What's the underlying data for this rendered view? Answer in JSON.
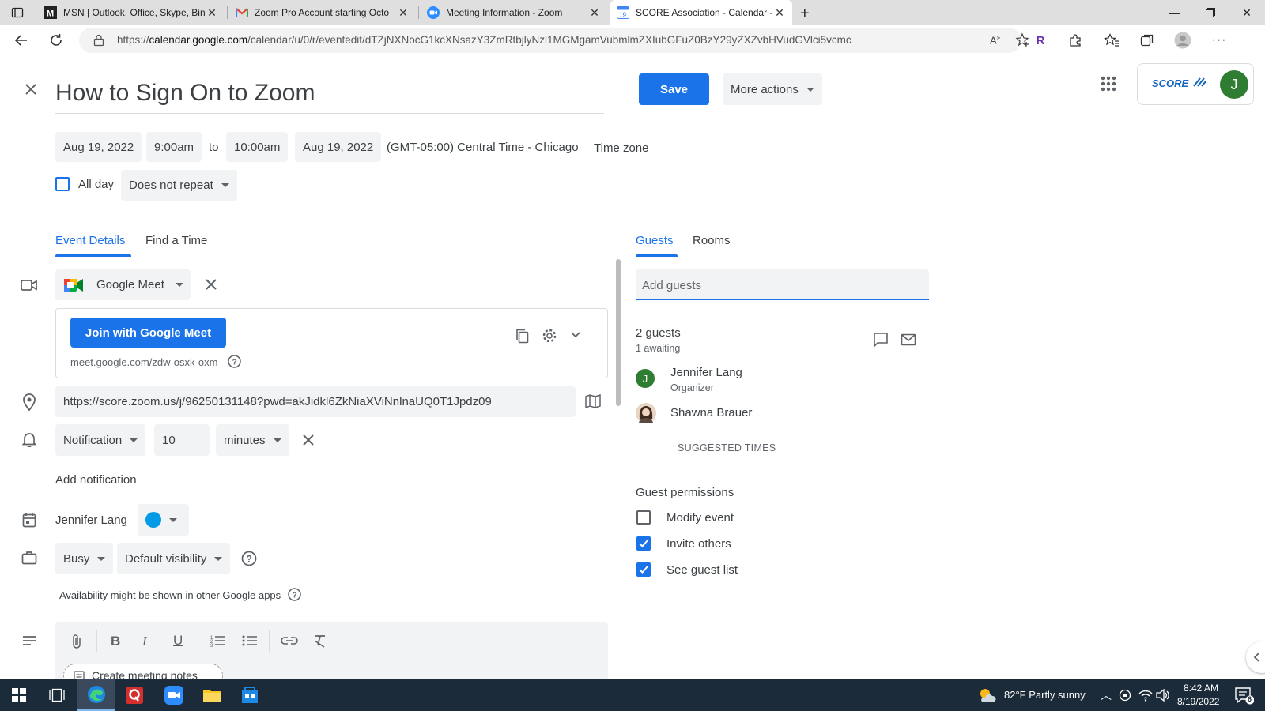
{
  "browser": {
    "tabs": [
      {
        "title": "MSN | Outlook, Office, Skype, Bing"
      },
      {
        "title": "Zoom Pro Account starting Octo"
      },
      {
        "title": "Meeting Information - Zoom"
      },
      {
        "title": "SCORE Association - Calendar - E"
      }
    ],
    "url_prefix": "https://",
    "url_host": "calendar.google.com",
    "url_path": "/calendar/u/0/r/eventedit/dTZjNXNocG1kcXNsazY3ZmRtbjlyNzl1MGMgamVubmlmZXIubGFuZ0BzY29yZXZvbHVudGVlci5vcmc",
    "profile_letter": "R"
  },
  "event": {
    "title": "How to Sign On to Zoom",
    "start_date": "Aug 19, 2022",
    "start_time": "9:00am",
    "to": "to",
    "end_time": "10:00am",
    "end_date": "Aug 19, 2022",
    "timezone": "(GMT-05:00) Central Time - Chicago",
    "timezone_link": "Time zone",
    "all_day_label": "All day",
    "repeat": "Does not repeat"
  },
  "header": {
    "save": "Save",
    "more_actions": "More actions",
    "brand": "SCORE",
    "avatar_letter": "J"
  },
  "tabs": {
    "event_details": "Event Details",
    "find_time": "Find a Time",
    "guests": "Guests",
    "rooms": "Rooms"
  },
  "conference": {
    "provider": "Google Meet",
    "join_button": "Join with Google Meet",
    "link": "meet.google.com/zdw-osxk-oxm"
  },
  "location": "https://score.zoom.us/j/96250131148?pwd=akJidkl6ZkNiaXViNnlnaUQ0T1Jpdz09",
  "notification": {
    "type": "Notification",
    "value": "10",
    "unit": "minutes",
    "add": "Add notification"
  },
  "calendar": {
    "owner": "Jennifer Lang",
    "color": "#039be5"
  },
  "availability": {
    "status": "Busy",
    "visibility": "Default visibility",
    "note": "Availability might be shown in other Google apps"
  },
  "notes": {
    "create": "Create meeting notes"
  },
  "guests": {
    "placeholder": "Add guests",
    "count": "2 guests",
    "awaiting": "1 awaiting",
    "list": [
      {
        "name": "Jennifer Lang",
        "role": "Organizer",
        "initial": "J"
      },
      {
        "name": "Shawna Brauer",
        "role": "",
        "initial": ""
      }
    ],
    "suggested": "SUGGESTED TIMES",
    "permissions_title": "Guest permissions",
    "permissions": [
      {
        "label": "Modify event",
        "checked": false
      },
      {
        "label": "Invite others",
        "checked": true
      },
      {
        "label": "See guest list",
        "checked": true
      }
    ]
  },
  "taskbar": {
    "weather": "82°F  Partly sunny",
    "time": "8:42 AM",
    "date": "8/19/2022",
    "notif_count": "6"
  },
  "colors": {
    "accent": "#1a73e8",
    "organizer_avatar": "#2e7d32"
  }
}
